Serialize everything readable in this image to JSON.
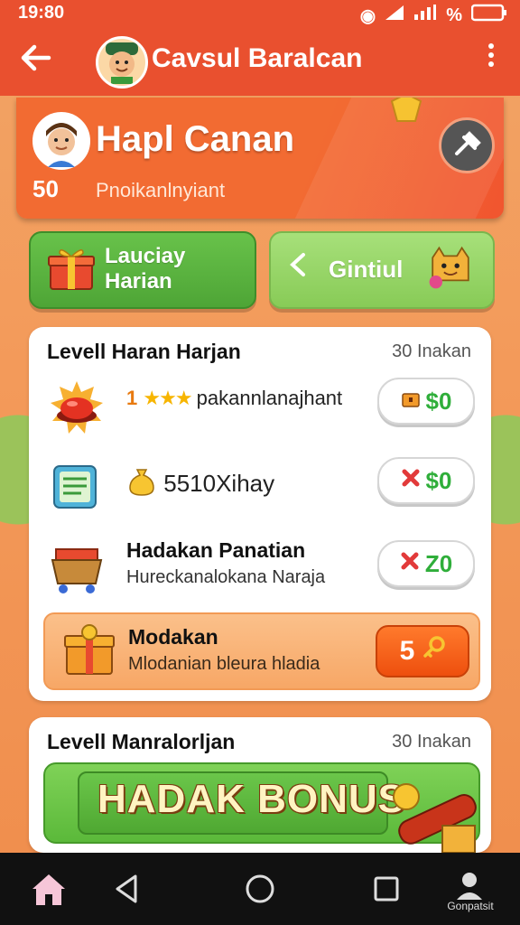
{
  "status_bar": {
    "time": "19:80",
    "battery_label": "%"
  },
  "app_bar": {
    "title": "Cavsul Baralcan",
    "back_icon": "arrow-left-icon",
    "menu_icon": "more-vert-icon"
  },
  "profile": {
    "name": "Hapl Canan",
    "level": "50",
    "subtitle": "Pnoikanlnyiant"
  },
  "tabs": [
    {
      "line1": "Lauciay",
      "line2": "Harian",
      "icon": "gift-box-icon",
      "active": true
    },
    {
      "label": "Gintiul",
      "icon": "treasure-creature-icon",
      "active": false
    }
  ],
  "daily_panel": {
    "title": "Levell Haran Harjan",
    "meta": "30 Inakan",
    "rows": [
      {
        "icon": "red-button-icon",
        "prefix": "1",
        "stars": "★★★",
        "text": "pakannlanajhant",
        "reward_icon": "chest-icon",
        "reward": "$0"
      },
      {
        "icon": "document-icon",
        "text": "5510Xihay",
        "reward_icon": "x-mark-icon",
        "reward": "$0"
      },
      {
        "icon": "cart-icon",
        "title": "Hadakan Panatian",
        "subtitle": "Hureckanalokana Naraja",
        "reward_icon": "x-mark-icon",
        "reward": "Z0"
      }
    ],
    "highlight": {
      "icon": "gift-box-icon",
      "title": "Modakan",
      "subtitle": "Mlodanian bleura hladia",
      "button_value": "5",
      "button_icon": "key-icon"
    }
  },
  "weekly_panel": {
    "title": "Levell Manralorljan",
    "meta": "30 Inakan",
    "bonus_label": "HADAK BONUS"
  },
  "nav": {
    "profile_label": "Gonpatsit"
  },
  "colors": {
    "app_bar": "#e9502f",
    "accent_green": "#4ea536",
    "reward_green": "#2fae3a",
    "claim_orange": "#ee4f0e"
  }
}
